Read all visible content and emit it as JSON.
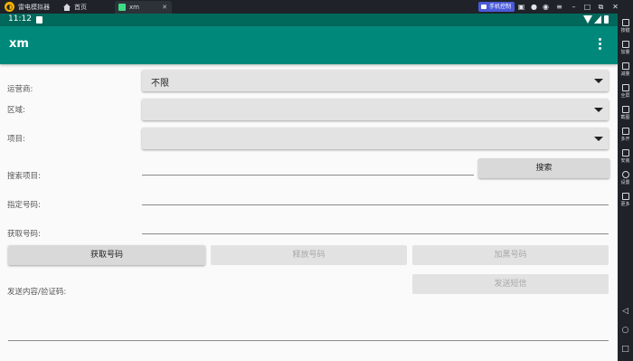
{
  "emulator": {
    "app_name": "雷电模拟器",
    "tabs": [
      {
        "label": "首页"
      },
      {
        "label": "xm"
      }
    ],
    "badge_label": "手机控制",
    "sidebar_tools": [
      {
        "label": "按键"
      },
      {
        "label": "加量"
      },
      {
        "label": "减量"
      },
      {
        "label": "全屏"
      },
      {
        "label": "截图"
      },
      {
        "label": "多开"
      },
      {
        "label": "安装"
      },
      {
        "label": "设置"
      },
      {
        "label": "更多"
      }
    ],
    "nav": {
      "back": "◁",
      "home": "○",
      "recents": "□"
    }
  },
  "statusbar": {
    "time": "11:12"
  },
  "appbar": {
    "title": "xm"
  },
  "form": {
    "operator": {
      "label": "运营商:",
      "value": "不限"
    },
    "region": {
      "label": "区域:",
      "value": ""
    },
    "project": {
      "label": "项目:",
      "value": ""
    },
    "search_project": {
      "label": "搜索项目:",
      "value": ""
    },
    "search_button": "搜索",
    "specified_number": {
      "label": "指定号码:",
      "value": ""
    },
    "obtained_number": {
      "label": "获取号码:",
      "value": ""
    },
    "get_number_button": "获取号码",
    "release_number_button": "释放号码",
    "blacklist_number_button": "加黑号码",
    "send_content": {
      "label": "发送内容/验证码:",
      "value": ""
    },
    "send_sms_button": "发送短信"
  },
  "colors": {
    "statusbar": "#00695c",
    "appbar": "#00897b",
    "emulator_chrome": "#1f2329",
    "badge": "#4a5ad8"
  }
}
